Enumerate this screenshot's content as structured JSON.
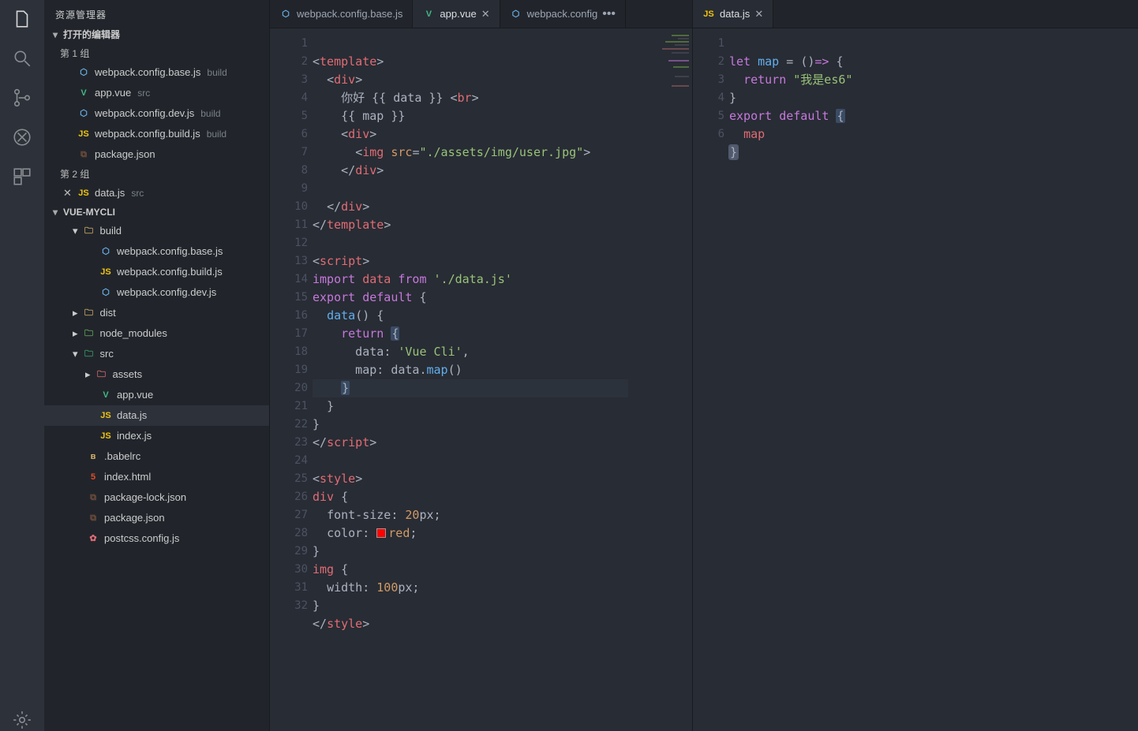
{
  "sidebar": {
    "title": "资源管理器",
    "openEditorsLabel": "打开的编辑器",
    "groups": [
      {
        "label": "第 1 组",
        "items": [
          {
            "icon": "wp",
            "name": "webpack.config.base.js",
            "hint": "build"
          },
          {
            "icon": "vue",
            "name": "app.vue",
            "hint": "src"
          },
          {
            "icon": "wp",
            "name": "webpack.config.dev.js",
            "hint": "build"
          },
          {
            "icon": "js",
            "name": "webpack.config.build.js",
            "hint": "build"
          },
          {
            "icon": "json",
            "name": "package.json",
            "hint": ""
          }
        ]
      },
      {
        "label": "第 2 组",
        "items": [
          {
            "icon": "js",
            "name": "data.js",
            "hint": "src",
            "hasX": true
          }
        ]
      }
    ],
    "project": "VUE-MYCLI",
    "tree": [
      {
        "type": "folder",
        "icon": "folder",
        "name": "build",
        "depth": 1,
        "open": true
      },
      {
        "type": "file",
        "icon": "wp",
        "name": "webpack.config.base.js",
        "depth": 2
      },
      {
        "type": "file",
        "icon": "js",
        "name": "webpack.config.build.js",
        "depth": 2
      },
      {
        "type": "file",
        "icon": "wp",
        "name": "webpack.config.dev.js",
        "depth": 2
      },
      {
        "type": "folder",
        "icon": "folder",
        "name": "dist",
        "depth": 1,
        "open": false
      },
      {
        "type": "folder",
        "icon": "mod",
        "name": "node_modules",
        "depth": 1,
        "open": false
      },
      {
        "type": "folder",
        "icon": "src",
        "name": "src",
        "depth": 1,
        "open": true
      },
      {
        "type": "folder",
        "icon": "css",
        "name": "assets",
        "depth": 2,
        "open": false
      },
      {
        "type": "file",
        "icon": "vue",
        "name": "app.vue",
        "depth": 2
      },
      {
        "type": "file",
        "icon": "js",
        "name": "data.js",
        "depth": 2,
        "selected": true
      },
      {
        "type": "file",
        "icon": "js",
        "name": "index.js",
        "depth": 2
      },
      {
        "type": "file",
        "icon": "b",
        "name": ".babelrc",
        "depth": 1
      },
      {
        "type": "file",
        "icon": "html",
        "name": "index.html",
        "depth": 1
      },
      {
        "type": "file",
        "icon": "json",
        "name": "package-lock.json",
        "depth": 1
      },
      {
        "type": "file",
        "icon": "json",
        "name": "package.json",
        "depth": 1
      },
      {
        "type": "file",
        "icon": "post",
        "name": "postcss.config.js",
        "depth": 1
      }
    ]
  },
  "leftPane": {
    "tabs": [
      {
        "icon": "wp",
        "label": "webpack.config.base.js",
        "active": false,
        "close": false
      },
      {
        "icon": "vue",
        "label": "app.vue",
        "active": true,
        "close": true
      },
      {
        "icon": "wp",
        "label": "webpack.config",
        "active": false,
        "close": false,
        "ellipsis": true
      }
    ],
    "lines": [
      1,
      2,
      3,
      4,
      5,
      6,
      7,
      8,
      9,
      10,
      11,
      12,
      13,
      14,
      15,
      16,
      17,
      18,
      19,
      20,
      21,
      22,
      23,
      24,
      25,
      26,
      27,
      28,
      29,
      30,
      31,
      32
    ],
    "code": {
      "l1": "<template>",
      "l2": "  <div>",
      "l3_a": "    你好 ",
      "l3_b": "{{ data }}",
      "l3_c": " <br>",
      "l4": "    {{ map }}",
      "l5": "    <div>",
      "l6_a": "      <img ",
      "l6_attr": "src",
      "l6_eq": "=",
      "l6_str": "\"./assets/img/user.jpg\"",
      "l6_end": ">",
      "l7": "    </div>",
      "l8": "",
      "l9": "  </div>",
      "l10": "</template>",
      "l11": "",
      "l12": "<script>",
      "l13_a": "import",
      "l13_b": " data ",
      "l13_c": "from",
      "l13_d": " './data.js'",
      "l14_a": "export",
      "l14_b": " default",
      "l14_c": " {",
      "l15_a": "  data",
      "l15_b": "() {",
      "l16": "    return",
      "l16_b": " {",
      "l17_a": "      data: ",
      "l17_b": "'Vue Cli'",
      "l17_c": ",",
      "l18_a": "      map: data.",
      "l18_b": "map",
      "l18_c": "()",
      "l19": "    }",
      "l20": "  }",
      "l21": "}",
      "l22": "</scr",
      "l22b": "ipt>",
      "l23": "",
      "l24": "<style>",
      "l25": "div {",
      "l26_a": "  font-size: ",
      "l26_b": "20",
      "l26_c": "px;",
      "l27_a": "  color: ",
      "l27_b": "red;",
      "l28": "}",
      "l29": "img {",
      "l30_a": "  width: ",
      "l30_b": "100",
      "l30_c": "px;",
      "l31": "}",
      "l32": "</style>"
    }
  },
  "rightPane": {
    "tabs": [
      {
        "icon": "js",
        "label": "data.js",
        "active": true,
        "close": true
      }
    ],
    "lines": [
      1,
      2,
      3,
      4,
      5,
      6
    ],
    "code": {
      "l1_a": "let",
      "l1_b": " map ",
      "l1_c": "=",
      "l1_d": " ()",
      "l1_e": "=>",
      "l1_f": " {",
      "l2_a": "  return",
      "l2_b": " \"我是es6\"",
      "l3": "}",
      "l4_a": "export",
      "l4_b": " default",
      "l4_c": " {",
      "l5": "  map",
      "l6": "}"
    }
  }
}
